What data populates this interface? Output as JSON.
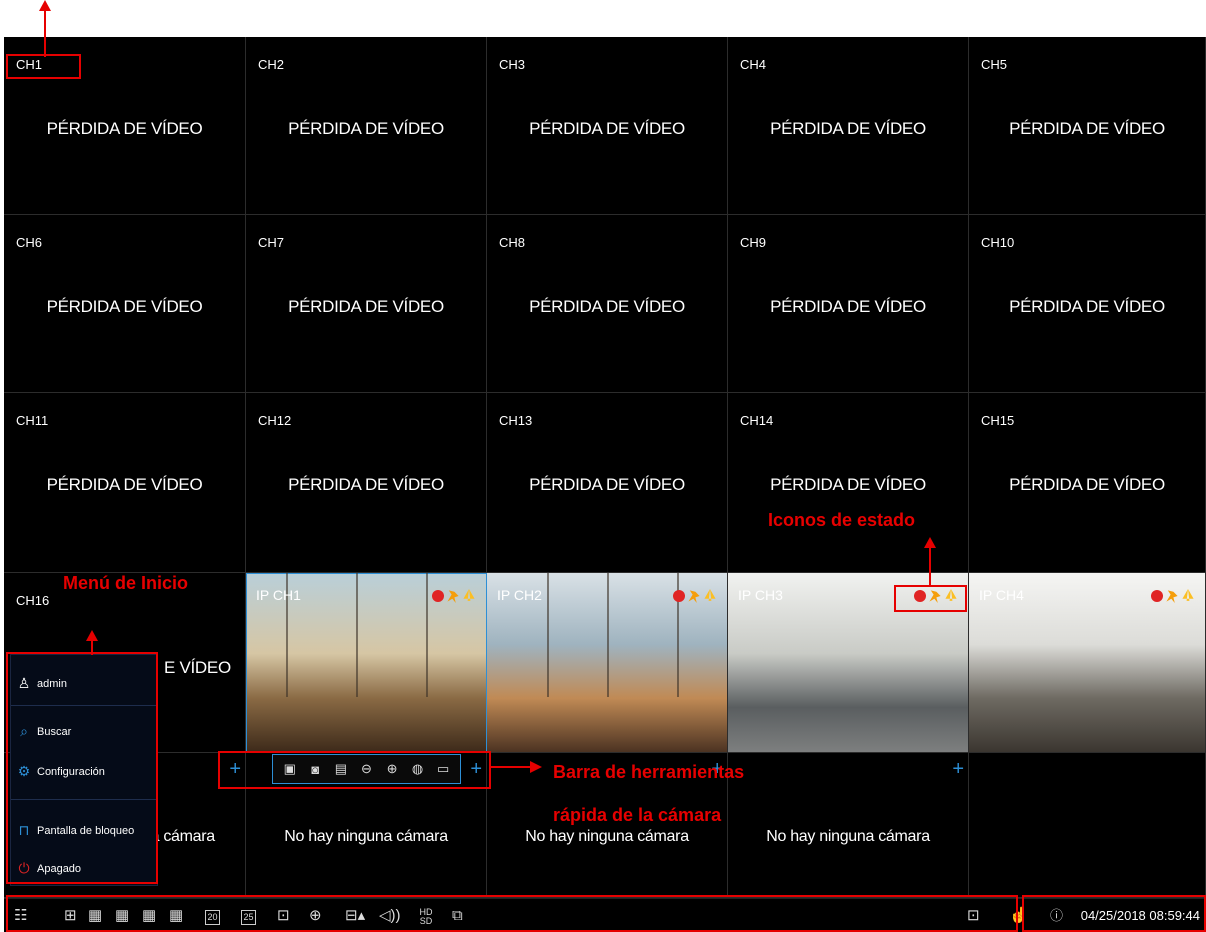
{
  "grid": {
    "video_loss_text": "PÉRDIDA DE VÍDEO",
    "no_camera_text": "No hay ninguna cámara",
    "channels": [
      "CH1",
      "CH2",
      "CH3",
      "CH4",
      "CH5",
      "CH6",
      "CH7",
      "CH8",
      "CH9",
      "CH10",
      "CH11",
      "CH12",
      "CH13",
      "CH14",
      "CH15",
      "CH16"
    ],
    "ip_channels": [
      "IP CH1",
      "IP CH2",
      "IP CH3",
      "IP CH4"
    ],
    "ch16_partial_msg": "E VÍDEO",
    "partial_no_camera": "na cámara"
  },
  "start_menu": {
    "user": "admin",
    "items": [
      "Buscar",
      "Configuración",
      "Pantalla de bloqueo",
      "Apagado"
    ]
  },
  "quick_toolbar": {
    "icons": [
      "record-icon",
      "snapshot-icon",
      "playback-icon",
      "ptz-icon",
      "zoom-icon",
      "color-icon",
      "stream-icon"
    ]
  },
  "taskbar": {
    "icons": [
      "start-menu-icon",
      "layout-4-icon",
      "layout-9-icon",
      "layout-16-icon",
      "layout-25-icon",
      "layout-20-icon",
      "layout-25-alt-icon",
      "pip-icon",
      "sequence-icon",
      "audio-icon",
      "hd-sd-icon",
      "network-camera-icon"
    ],
    "layout_labels": [
      "20",
      "25"
    ],
    "hd_label": "HD SD",
    "datetime": "04/25/2018 08:59:44"
  },
  "annotations": {
    "start_menu_label": "Menú de Inicio",
    "status_icons_label": "Iconos de estado",
    "toolbar_label_line1": "Barra de herramientas",
    "toolbar_label_line2": "rápida de la cámara"
  }
}
